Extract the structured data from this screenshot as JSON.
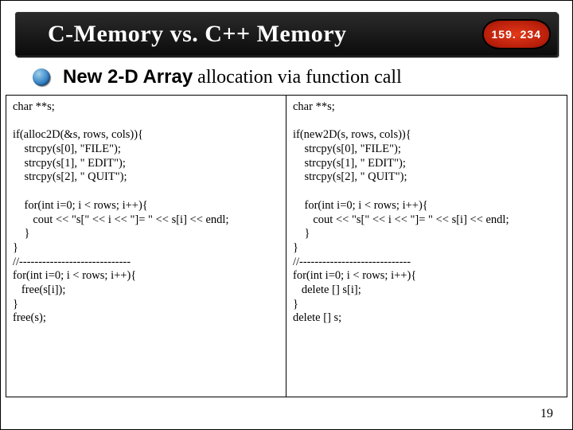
{
  "badge": "159. 234",
  "title": "C-Memory vs. C++ Memory",
  "subhead_bold": "New 2-D Array",
  "subhead_rest": "allocation via function call",
  "code_left": "char **s;\n\nif(alloc2D(&s, rows, cols)){\n    strcpy(s[0], \"FILE\");\n    strcpy(s[1], \" EDIT\");\n    strcpy(s[2], \" QUIT\");\n\n    for(int i=0; i < rows; i++){\n       cout << \"s[\" << i << \"]= \" << s[i] << endl;\n    }\n}\n//-----------------------------\nfor(int i=0; i < rows; i++){\n   free(s[i]);\n}\nfree(s);",
  "code_right": "char **s;\n\nif(new2D(s, rows, cols)){\n    strcpy(s[0], \"FILE\");\n    strcpy(s[1], \" EDIT\");\n    strcpy(s[2], \" QUIT\");\n\n    for(int i=0; i < rows; i++){\n       cout << \"s[\" << i << \"]= \" << s[i] << endl;\n    }\n}\n//-----------------------------\nfor(int i=0; i < rows; i++){\n   delete [] s[i];\n}\ndelete [] s;",
  "page_number": "19"
}
